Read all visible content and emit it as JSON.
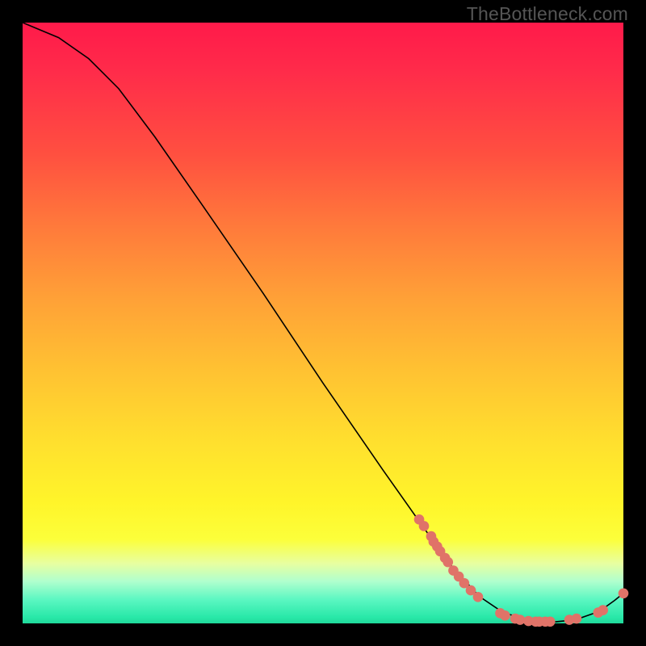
{
  "watermark": "TheBottleneck.com",
  "chart_data": {
    "type": "line",
    "title": "",
    "xlabel": "",
    "ylabel": "",
    "xlim": [
      0,
      100
    ],
    "ylim": [
      0,
      100
    ],
    "curve": [
      {
        "x": 0.0,
        "y": 100.0
      },
      {
        "x": 6.0,
        "y": 97.5
      },
      {
        "x": 11.0,
        "y": 94.0
      },
      {
        "x": 16.0,
        "y": 89.0
      },
      {
        "x": 22.0,
        "y": 81.0
      },
      {
        "x": 30.0,
        "y": 69.5
      },
      {
        "x": 40.0,
        "y": 55.0
      },
      {
        "x": 50.0,
        "y": 40.0
      },
      {
        "x": 60.0,
        "y": 25.5
      },
      {
        "x": 66.0,
        "y": 17.0
      },
      {
        "x": 71.0,
        "y": 10.0
      },
      {
        "x": 76.0,
        "y": 4.5
      },
      {
        "x": 80.0,
        "y": 1.8
      },
      {
        "x": 84.0,
        "y": 0.6
      },
      {
        "x": 88.0,
        "y": 0.2
      },
      {
        "x": 92.0,
        "y": 0.6
      },
      {
        "x": 96.0,
        "y": 2.0
      },
      {
        "x": 98.5,
        "y": 3.8
      },
      {
        "x": 100.0,
        "y": 5.0
      }
    ],
    "scatter": [
      {
        "x": 66.0,
        "y": 17.3
      },
      {
        "x": 66.8,
        "y": 16.2
      },
      {
        "x": 68.0,
        "y": 14.5
      },
      {
        "x": 68.4,
        "y": 13.6
      },
      {
        "x": 69.0,
        "y": 12.8
      },
      {
        "x": 69.5,
        "y": 12.0
      },
      {
        "x": 70.3,
        "y": 10.9
      },
      {
        "x": 70.8,
        "y": 10.2
      },
      {
        "x": 71.7,
        "y": 8.8
      },
      {
        "x": 72.6,
        "y": 7.8
      },
      {
        "x": 73.5,
        "y": 6.7
      },
      {
        "x": 74.6,
        "y": 5.5
      },
      {
        "x": 75.8,
        "y": 4.4
      },
      {
        "x": 79.5,
        "y": 1.7
      },
      {
        "x": 80.3,
        "y": 1.3
      },
      {
        "x": 82.0,
        "y": 0.8
      },
      {
        "x": 82.8,
        "y": 0.6
      },
      {
        "x": 84.2,
        "y": 0.4
      },
      {
        "x": 85.4,
        "y": 0.3
      },
      {
        "x": 86.0,
        "y": 0.3
      },
      {
        "x": 87.0,
        "y": 0.3
      },
      {
        "x": 87.8,
        "y": 0.3
      },
      {
        "x": 91.0,
        "y": 0.6
      },
      {
        "x": 92.2,
        "y": 0.8
      },
      {
        "x": 95.8,
        "y": 1.8
      },
      {
        "x": 96.6,
        "y": 2.2
      },
      {
        "x": 100.0,
        "y": 5.0
      }
    ],
    "gradient_colors": {
      "top": "#ff1a4a",
      "upper_mid": "#ffa137",
      "mid": "#ffe02e",
      "lower_mid": "#fcff3a",
      "bottom": "#28e8a8"
    },
    "dot_color": "#e07368"
  }
}
